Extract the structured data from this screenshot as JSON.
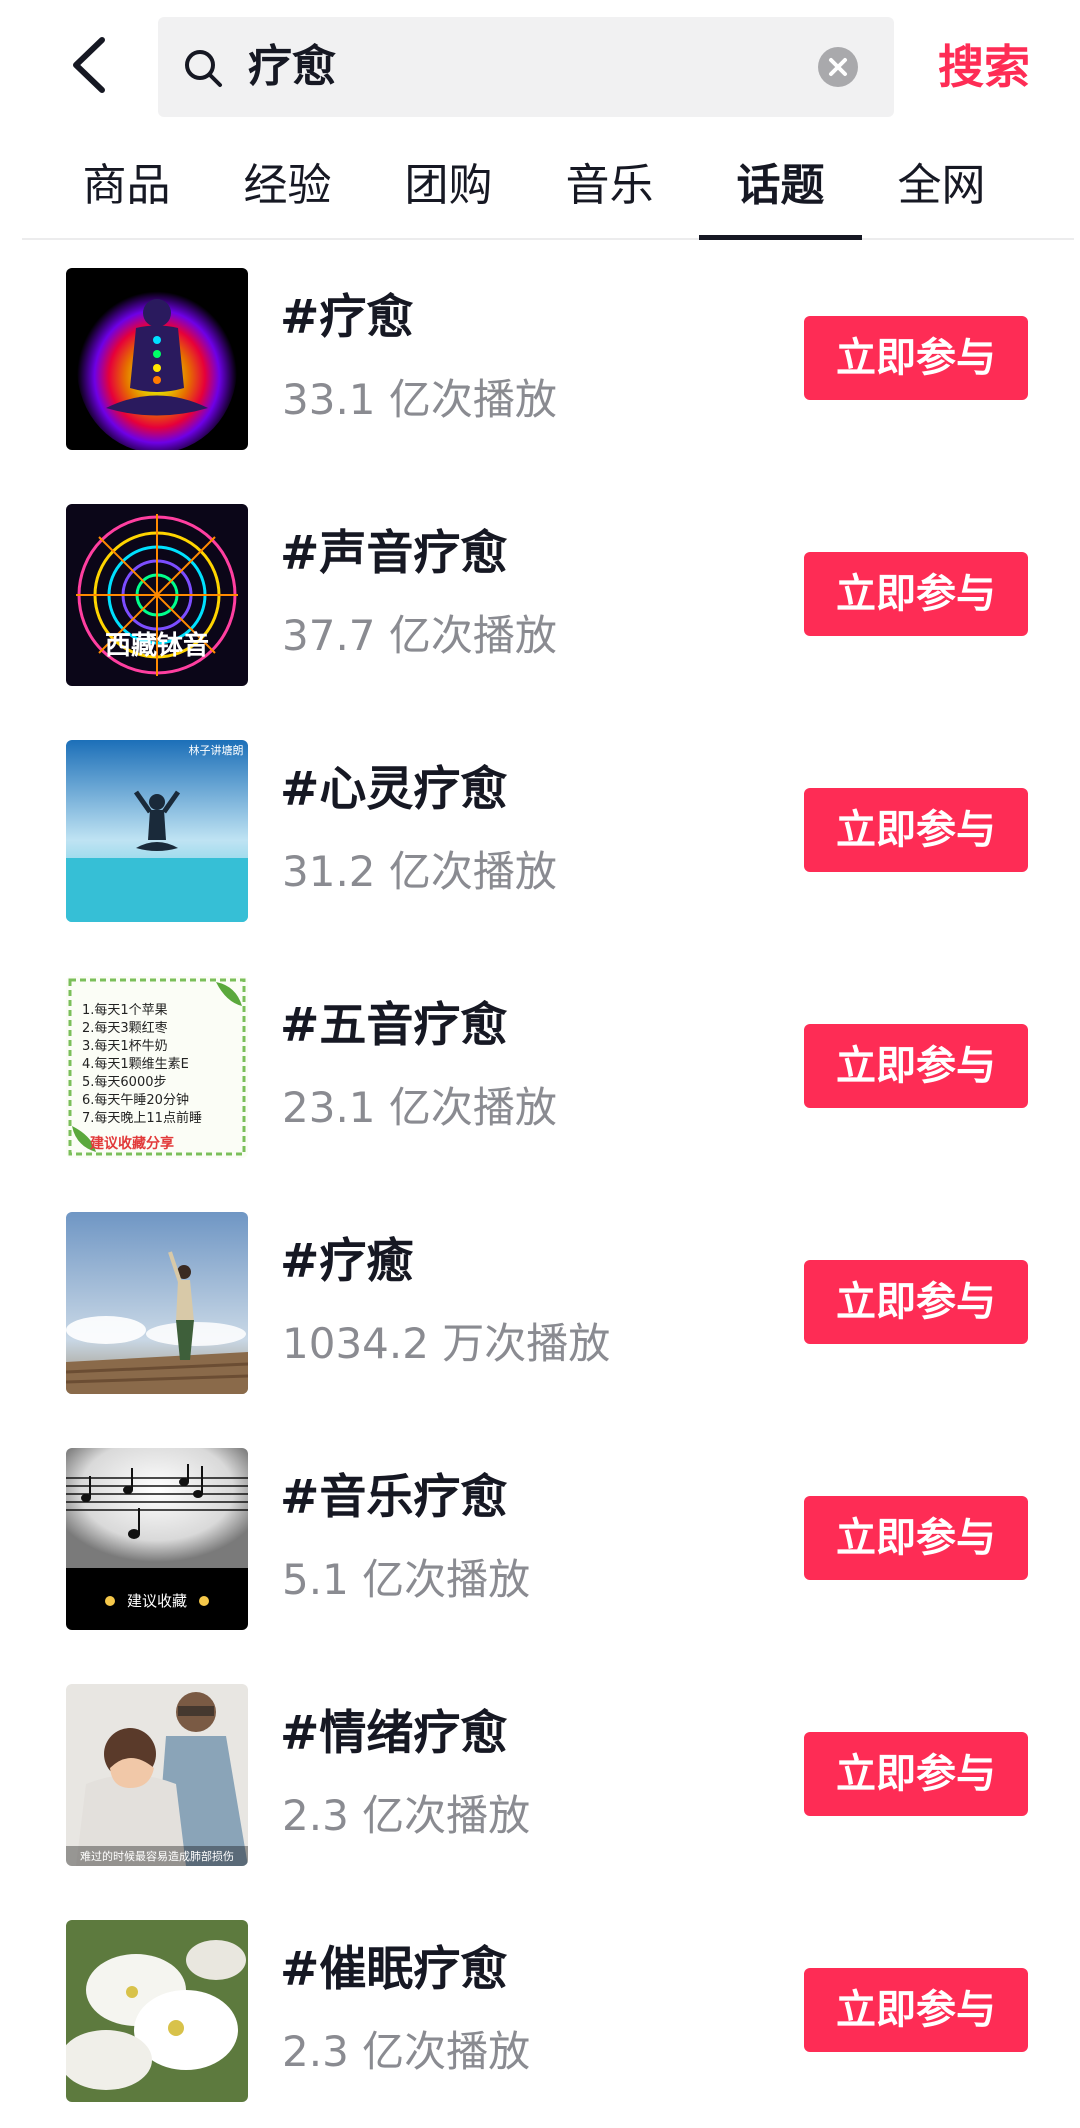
{
  "header": {
    "search_query": "疗愈",
    "search_submit_label": "搜索"
  },
  "tabs": [
    {
      "label": "商品",
      "active": false
    },
    {
      "label": "经验",
      "active": false
    },
    {
      "label": "团购",
      "active": false
    },
    {
      "label": "音乐",
      "active": false
    },
    {
      "label": "话题",
      "active": true
    },
    {
      "label": "全网",
      "active": false
    }
  ],
  "topics": [
    {
      "name": "#疗愈",
      "plays": "33.1 亿次播放",
      "button": "立即参与",
      "thumb_text": ""
    },
    {
      "name": "#声音疗愈",
      "plays": "37.7 亿次播放",
      "button": "立即参与",
      "thumb_text": "西藏钵音"
    },
    {
      "name": "#心灵疗愈",
      "plays": "31.2 亿次播放",
      "button": "立即参与",
      "thumb_text": "林子讲塘朗"
    },
    {
      "name": "#五音疗愈",
      "plays": "23.1 亿次播放",
      "button": "立即参与",
      "thumb_text": "建议收藏分享",
      "thumb_lines": [
        "1.每天1个苹果",
        "2.每天3颗红枣",
        "3.每天1杯牛奶",
        "4.每天1颗维生素E",
        "5.每天6000步",
        "6.每天午睡20分钟",
        "7.每天晚上11点前睡"
      ]
    },
    {
      "name": "#疗癒",
      "plays": "1034.2 万次播放",
      "button": "立即参与",
      "thumb_text": ""
    },
    {
      "name": "#音乐疗愈",
      "plays": "5.1 亿次播放",
      "button": "立即参与",
      "thumb_text": "建议收藏"
    },
    {
      "name": "#情绪疗愈",
      "plays": "2.3 亿次播放",
      "button": "立即参与",
      "thumb_text": "难过的时候最容易造成肺部损伤"
    },
    {
      "name": "#催眠疗愈",
      "plays": "2.3 亿次播放",
      "button": "立即参与",
      "thumb_text": ""
    }
  ],
  "colors": {
    "accent": "#fe2c55",
    "text_primary": "#161823",
    "text_secondary": "#8a8b91",
    "search_bg": "#f1f1f2"
  },
  "icons": {
    "back": "chevron-left-icon",
    "search": "search-icon",
    "clear": "clear-icon"
  }
}
